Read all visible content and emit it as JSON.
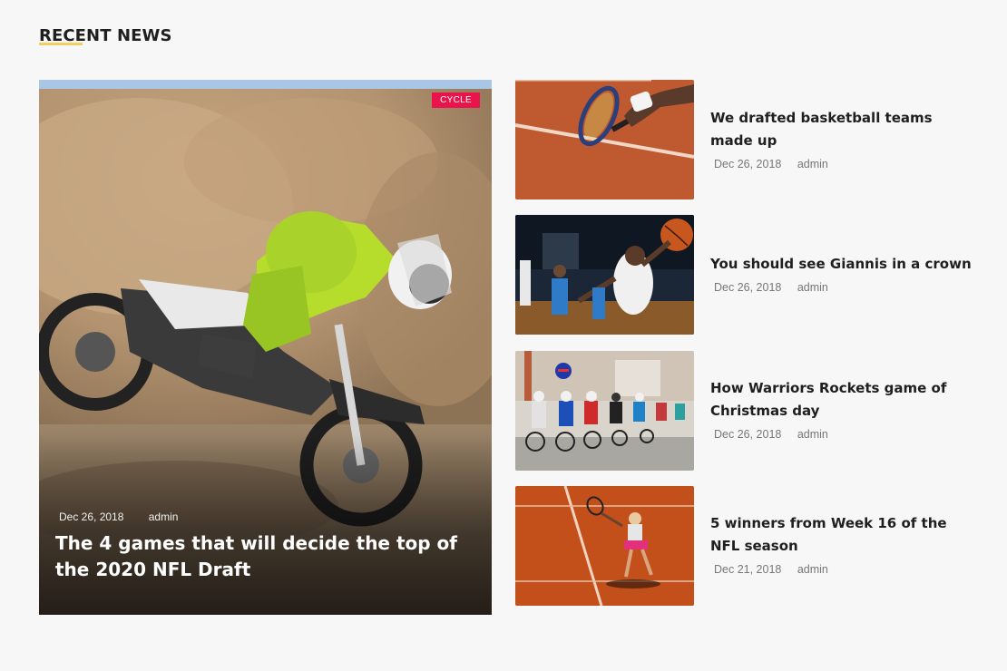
{
  "section": {
    "title": "RECENT NEWS"
  },
  "featured": {
    "category": "CYCLE",
    "date": "Dec 26, 2018",
    "author": "admin",
    "title": "The 4 games that will decide the top of the 2020 NFL Draft"
  },
  "news": [
    {
      "title": "We drafted basketball teams made up",
      "date": "Dec 26, 2018",
      "author": "admin"
    },
    {
      "title": "You should see Giannis in a crown",
      "date": "Dec 26, 2018",
      "author": "admin"
    },
    {
      "title": "How Warriors Rockets game of Christmas day",
      "date": "Dec 26, 2018",
      "author": "admin"
    },
    {
      "title": "5 winners from Week 16 of the NFL season",
      "date": "Dec 21, 2018",
      "author": "admin"
    }
  ]
}
